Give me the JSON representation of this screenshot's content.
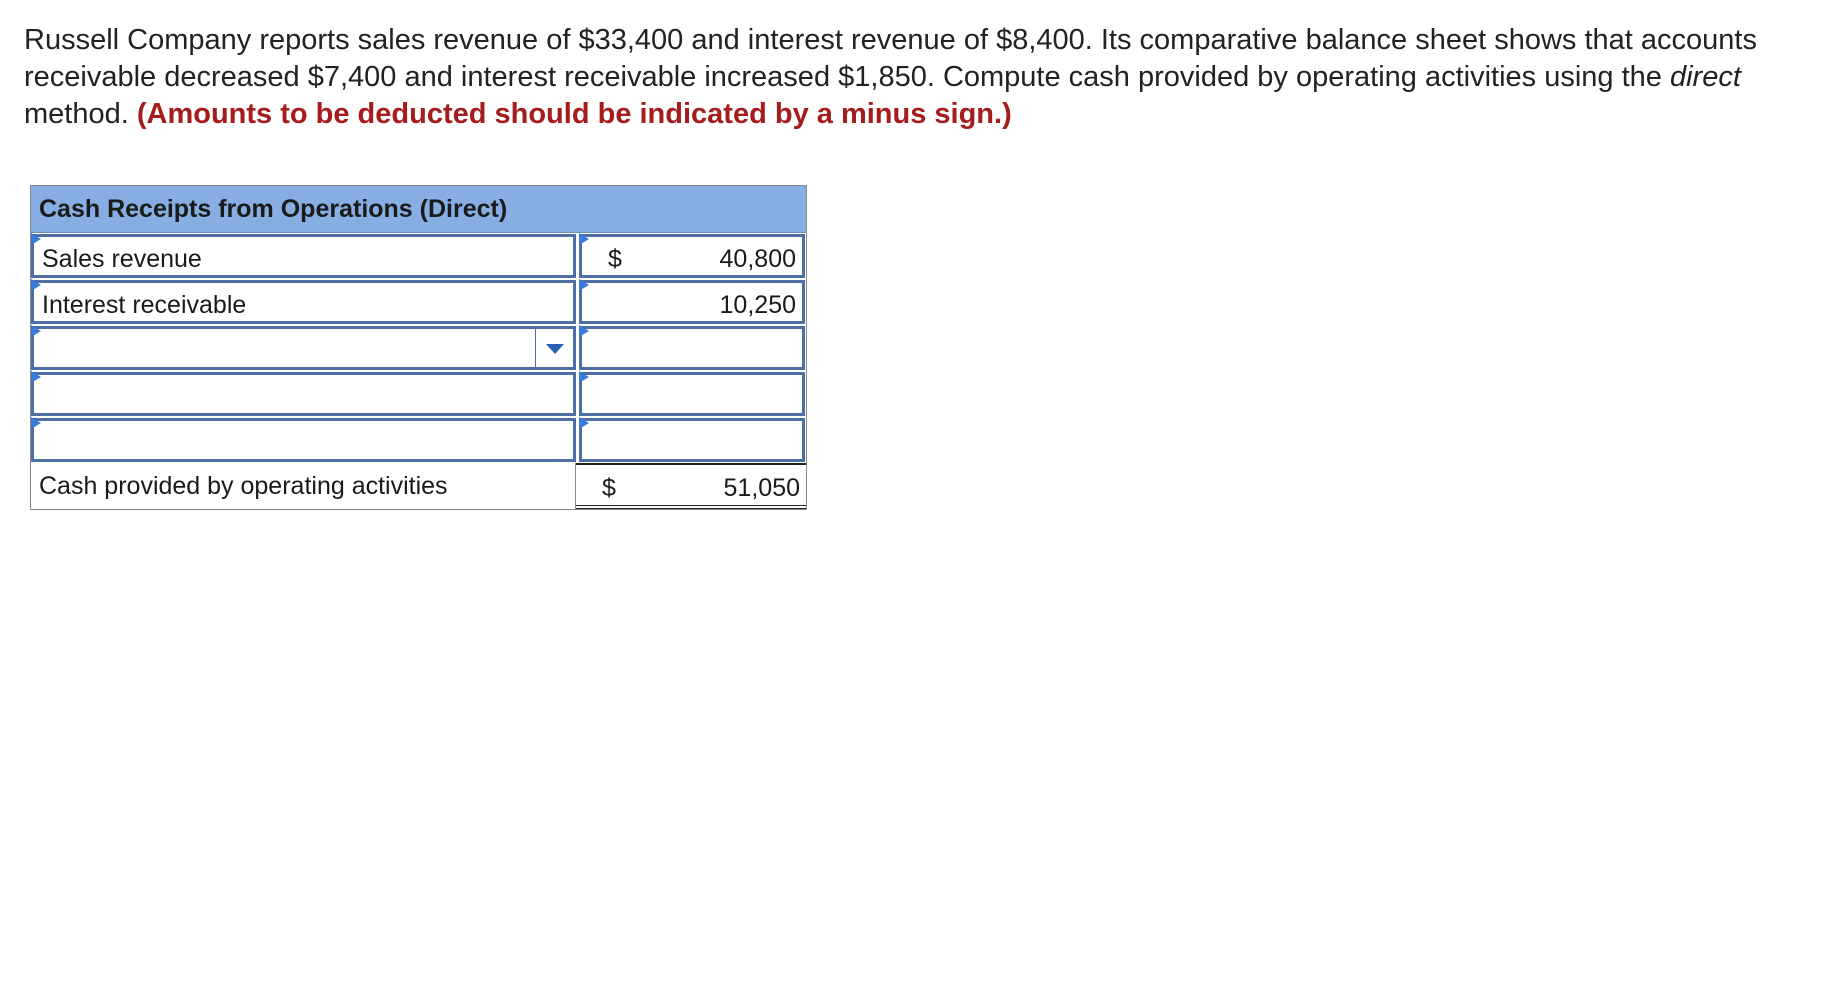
{
  "question": {
    "text_part1": "Russell Company reports sales revenue of $33,400 and interest revenue of $8,400. Its comparative balance sheet shows that accounts receivable decreased $7,400 and interest receivable increased $1,850. Compute cash provided by operating activities using the ",
    "emphasis": "direct",
    "text_part2": " method. ",
    "hint": "(Amounts to be deducted should be indicated by a minus sign.)"
  },
  "table": {
    "header": "Cash Receipts from Operations (Direct)",
    "rows": [
      {
        "label": "Sales revenue",
        "currency": "$",
        "amount": "40,800"
      },
      {
        "label": "Interest receivable",
        "currency": "",
        "amount": "10,250"
      },
      {
        "label": "",
        "currency": "",
        "amount": ""
      },
      {
        "label": "",
        "currency": "",
        "amount": ""
      },
      {
        "label": "",
        "currency": "",
        "amount": ""
      }
    ],
    "total": {
      "label": "Cash provided by operating activities",
      "currency": "$",
      "amount": "51,050"
    }
  },
  "colors": {
    "header_bg": "#86aee2",
    "input_border": "#4d6fa3",
    "hint_color": "#a51c1c",
    "marker": "#3a7ad8"
  },
  "icons": {
    "dropdown": "chevron-down-icon",
    "row_marker": "row-marker-icon"
  }
}
